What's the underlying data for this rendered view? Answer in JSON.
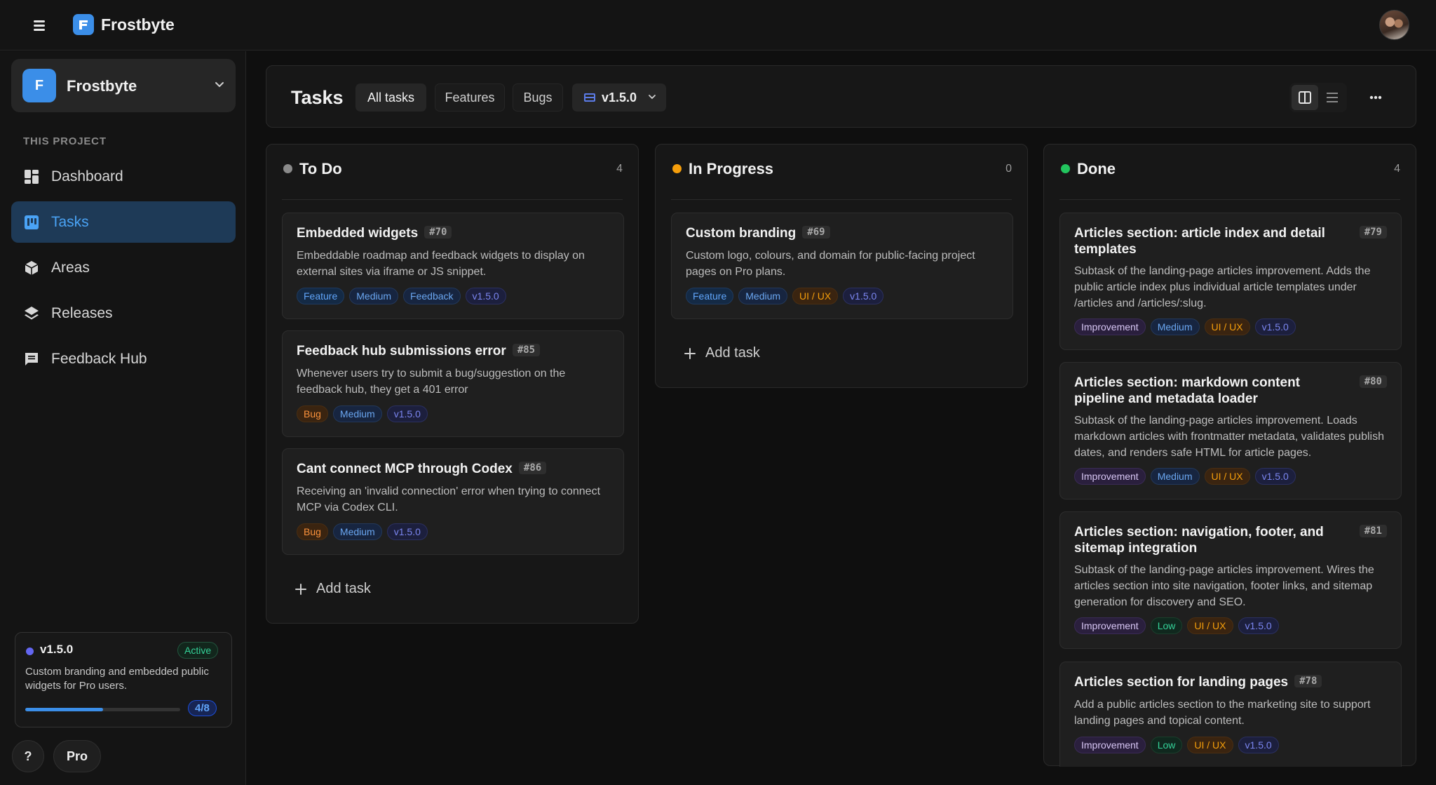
{
  "app": {
    "name": "Frostbyte"
  },
  "sidebar": {
    "project_initial": "F",
    "project_name": "Frostbyte",
    "section_label": "THIS PROJECT",
    "items": [
      {
        "label": "Dashboard",
        "icon": "dashboard-icon"
      },
      {
        "label": "Tasks",
        "icon": "tasks-icon",
        "active": true
      },
      {
        "label": "Areas",
        "icon": "cube-icon"
      },
      {
        "label": "Releases",
        "icon": "layers-icon"
      },
      {
        "label": "Feedback Hub",
        "icon": "chat-icon"
      }
    ],
    "release": {
      "version": "v1.5.0",
      "status": "Active",
      "description": "Custom branding and embedded public widgets for Pro users.",
      "progress": 0.5,
      "progress_label": "4/8"
    },
    "help_label": "?",
    "pro_label": "Pro"
  },
  "header": {
    "title": "Tasks",
    "tabs": [
      {
        "label": "All tasks",
        "active": true
      },
      {
        "label": "Features"
      },
      {
        "label": "Bugs"
      }
    ],
    "version_filter": "v1.5.0"
  },
  "columns": [
    {
      "title": "To Do",
      "count": "4",
      "dot_color": "#8a8a8a",
      "add_label": "Add task",
      "cards": [
        {
          "title": "Embedded widgets",
          "number": "#70",
          "description": "Embeddable roadmap and feedback widgets to display on external sites via iframe or JS snippet.",
          "tags": [
            "Feature",
            "Medium",
            "Feedback",
            "v1.5.0"
          ]
        },
        {
          "title": "Feedback hub submissions error",
          "number": "#85",
          "description": "Whenever users try to submit a bug/suggestion on the feedback hub, they get a 401 error",
          "tags": [
            "Bug",
            "Medium",
            "v1.5.0"
          ]
        },
        {
          "title": "Cant connect MCP through Codex",
          "number": "#86",
          "description": "Receiving an 'invalid connection' error when trying to connect MCP via Codex CLI.",
          "tags": [
            "Bug",
            "Medium",
            "v1.5.0"
          ]
        }
      ]
    },
    {
      "title": "In Progress",
      "count": "0",
      "dot_color": "#f59e0b",
      "add_label": "Add task",
      "cards": [
        {
          "title": "Custom branding",
          "number": "#69",
          "description": "Custom logo, colours, and domain for public-facing project pages on Pro plans.",
          "tags": [
            "Feature",
            "Medium",
            "UI / UX",
            "v1.5.0"
          ]
        }
      ]
    },
    {
      "title": "Done",
      "count": "4",
      "dot_color": "#22c55e",
      "cards": [
        {
          "title": "Articles section: article index and detail templates",
          "number": "#79",
          "description": "Subtask of the landing-page articles improvement. Adds the public article index plus individual article templates under /articles and /articles/:slug.",
          "tags": [
            "Improvement",
            "Medium",
            "UI / UX",
            "v1.5.0"
          ]
        },
        {
          "title": "Articles section: markdown content pipeline and metadata loader",
          "number": "#80",
          "description": "Subtask of the landing-page articles improvement. Loads markdown articles with frontmatter metadata, validates publish dates, and renders safe HTML for article pages.",
          "tags": [
            "Improvement",
            "Medium",
            "UI / UX",
            "v1.5.0"
          ]
        },
        {
          "title": "Articles section: navigation, footer, and sitemap integration",
          "number": "#81",
          "description": "Subtask of the landing-page articles improvement. Wires the articles section into site navigation, footer links, and sitemap generation for discovery and SEO.",
          "tags": [
            "Improvement",
            "Low",
            "UI / UX",
            "v1.5.0"
          ]
        },
        {
          "title": "Articles section for landing pages",
          "number": "#78",
          "description": "Add a public articles section to the marketing site to support landing pages and topical content.",
          "tags": [
            "Improvement",
            "Low",
            "UI / UX",
            "v1.5.0"
          ]
        }
      ]
    }
  ]
}
